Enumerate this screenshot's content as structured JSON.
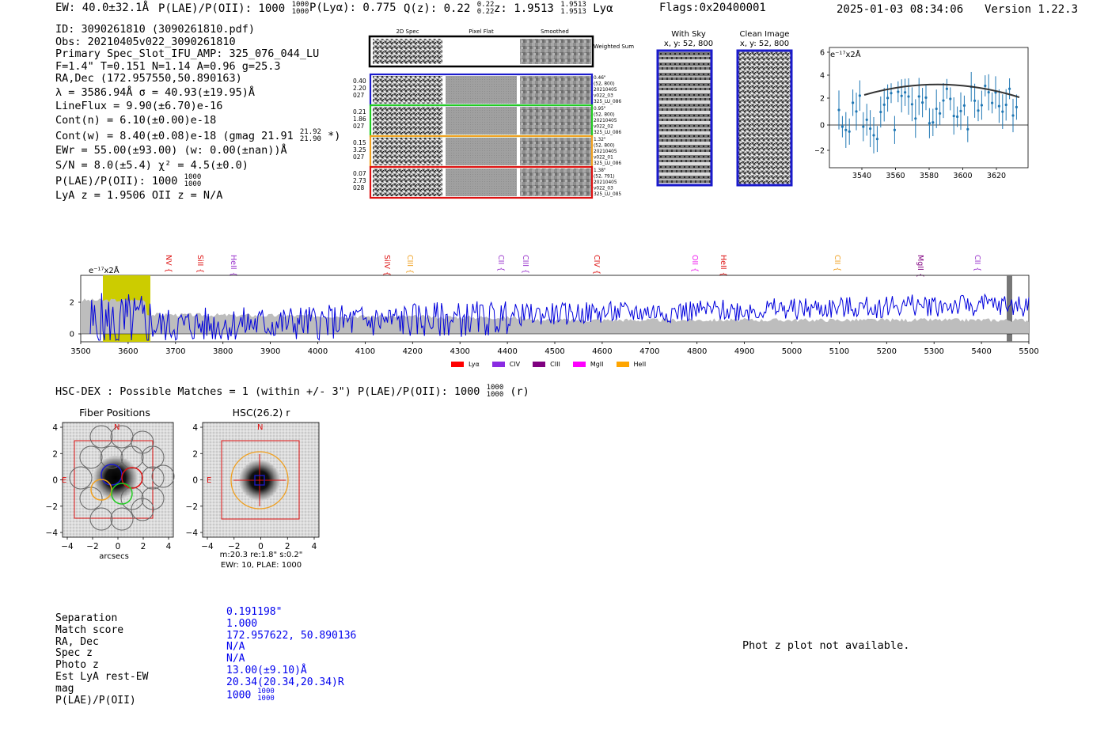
{
  "header": {
    "ew": "EW: 40.0±32.1Å",
    "plae_label": "P(LAE)/P(OII): 1000",
    "plae_hi": "1000",
    "plae_lo": "1000",
    "plya": "P(Lyα): 0.775",
    "qz_label": "Q(z): 0.22",
    "qz_hi": "0.22",
    "qz_lo": "0.22",
    "z_label": "z: 1.9513",
    "z_hi": "1.9513",
    "z_lo": "1.9513",
    "z_line": "Lyα",
    "flags": "Flags:0x20400001",
    "timestamp": "2025-01-03 08:34:06",
    "version": "Version 1.22.3"
  },
  "info": {
    "id": "ID: 3090261810 (3090261810.pdf)",
    "obs": "Obs: 20210405v022_3090261810",
    "primary": "Primary Spec_Slot_IFU_AMP: 325_076_044_LU",
    "params": "F=1.4\"  T=0.151  N=1.14  A=0.96  g=25.3",
    "radec": "RA,Dec (172.957550,50.890163)",
    "lambda": "λ = 3586.94Å  σ = 40.93(±19.95)Å",
    "lineflux": "LineFlux = 9.90(±6.70)e-16",
    "contn": "Cont(n) = 6.10(±0.00)e-18",
    "contw": "Cont(w) = 8.40(±0.08)e-18 (gmag 21.91",
    "contw_hi": "21.92",
    "contw_lo": "21.90",
    "contw_end": "*)",
    "ewr": "EWr = 55.00(±93.00) (w: 0.00(±nan))Å",
    "sn": "S/N = 8.0(±5.4)  χ² = 4.5(±0.0)",
    "plae": "P(LAE)/P(OII): 1000",
    "plae_hi": "1000",
    "plae_lo": "1000",
    "lyaz": "LyA z = 1.9506  OII z = N/A"
  },
  "cutouts": {
    "col_headers": [
      "2D Spec",
      "Pixel Flat",
      "Smoothed"
    ],
    "weighted_sum": "Weighted Sum",
    "rows": [
      {
        "left": [
          "0.40",
          "2.20",
          "027"
        ],
        "right": [
          "0.46\"",
          "(52, 800)",
          "20210405",
          "v022_03",
          "325_LU_086"
        ],
        "color": "#1a1acc"
      },
      {
        "left": [
          "0.21",
          "1.86",
          "027"
        ],
        "right": [
          "0.95\"",
          "(52, 800)",
          "20210405",
          "v022_02",
          "325_LU_086"
        ],
        "color": "#22cc22"
      },
      {
        "left": [
          "0.15",
          "3.25",
          "027"
        ],
        "right": [
          "1.32\"",
          "(52, 800)",
          "20210405",
          "v022_01",
          "325_LU_086"
        ],
        "color": "#f0a020"
      },
      {
        "left": [
          "0.07",
          "2.73",
          "028"
        ],
        "right": [
          "1.38\"",
          "(52, 791)",
          "20210405",
          "v022_03",
          "325_LU_085"
        ],
        "color": "#dd1111"
      }
    ]
  },
  "sky": {
    "with_title": "With Sky",
    "with_sub": "x, y: 52, 800",
    "clean_title": "Clean Image",
    "clean_sub": "x, y: 52, 800"
  },
  "zoom_plot": {
    "scale_label": "e⁻¹⁷x2Å",
    "x_ticks": [
      "3540",
      "3560",
      "3580",
      "3600",
      "3620"
    ],
    "y_ticks": [
      "6",
      "4",
      "2",
      "0",
      "−2"
    ]
  },
  "spectrum": {
    "scale_label": "e⁻¹⁷x2Å",
    "x_ticks": [
      "3500",
      "3600",
      "3700",
      "3800",
      "3900",
      "4000",
      "4100",
      "4200",
      "4300",
      "4400",
      "4500",
      "4600",
      "4700",
      "4800",
      "4900",
      "5000",
      "5100",
      "5200",
      "5300",
      "5400",
      "5500"
    ],
    "y_ticks": [
      "2",
      "0"
    ],
    "lines": [
      {
        "label": "NV",
        "color": "#dd1111"
      },
      {
        "label": "SiII",
        "color": "#dd1111"
      },
      {
        "label": "HeII",
        "color": "#9933cc"
      },
      {
        "label": "SiIV",
        "color": "#dd1111"
      },
      {
        "label": "CIII",
        "color": "#f0a020"
      },
      {
        "label": "CII",
        "color": "#9933cc"
      },
      {
        "label": "CIII",
        "color": "#9933cc"
      },
      {
        "label": "CIV",
        "color": "#dd1111"
      },
      {
        "label": "OII",
        "color": "#ee22ee"
      },
      {
        "label": "HeII",
        "color": "#dd1111"
      },
      {
        "label": "CII",
        "color": "#f0a020"
      },
      {
        "label": "MgII",
        "color": "#800080"
      },
      {
        "label": "CII",
        "color": "#9933cc"
      }
    ],
    "legend": [
      {
        "label": "Lyα",
        "color": "#ff0000"
      },
      {
        "label": "CIV",
        "color": "#8a2be2"
      },
      {
        "label": "CIII",
        "color": "#800080"
      },
      {
        "label": "MgII",
        "color": "#ff00ff"
      },
      {
        "label": "HeII",
        "color": "#ffa500"
      }
    ]
  },
  "hsc": {
    "title_line": "HSC-DEX : Possible Matches = 1 (within +/- 3\")  P(LAE)/P(OII): 1000",
    "title_hi": "1000",
    "title_lo": "1000",
    "title_end": "(r)",
    "fiber_title": "Fiber Positions",
    "hsc_title": "HSC(26.2) r",
    "ticks": [
      "4",
      "2",
      "0",
      "−2",
      "−4"
    ],
    "xticks": [
      "−4",
      "−2",
      "0",
      "2",
      "4"
    ],
    "xlabel": "arcsecs",
    "north": "N",
    "east": "E",
    "caption1": "m:20.3  re:1.8\"  s:0.2\"",
    "caption2": "EWr: 10, PLAE: 1000"
  },
  "match_table": {
    "labels": [
      "Separation",
      "Match score",
      "RA, Dec",
      "Spec z",
      "Photo z",
      "Est LyA rest-EW",
      "mag",
      "P(LAE)/P(OII)"
    ],
    "values": [
      "0.191198\"",
      "1.000",
      "172.957622, 50.890136",
      "N/A",
      "N/A",
      "13.00(±9.10)Å",
      "20.34(20.34,20.34)R",
      "1000"
    ],
    "plae_hi": "1000",
    "plae_lo": "1000"
  },
  "photz_message": "Phot z plot not available."
}
